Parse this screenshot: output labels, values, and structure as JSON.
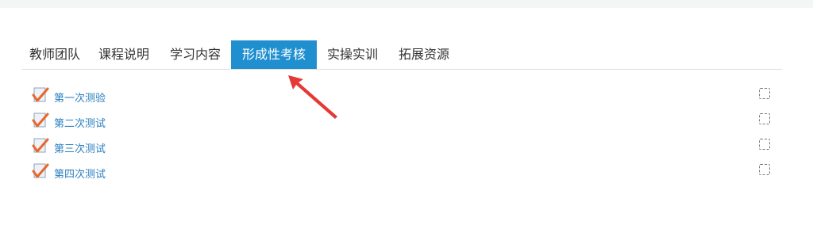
{
  "tabs": [
    {
      "label": "教师团队",
      "active": false
    },
    {
      "label": "课程说明",
      "active": false
    },
    {
      "label": "学习内容",
      "active": false
    },
    {
      "label": "形成性考核",
      "active": true
    },
    {
      "label": "实操实训",
      "active": false
    },
    {
      "label": "拓展资源",
      "active": false
    }
  ],
  "activities": [
    {
      "label": "第一次测验",
      "icon": "quiz-check-icon",
      "completed": false
    },
    {
      "label": "第二次测试",
      "icon": "quiz-check-icon",
      "completed": false
    },
    {
      "label": "第三次测试",
      "icon": "quiz-check-icon",
      "completed": false
    },
    {
      "label": "第四次测试",
      "icon": "quiz-check-icon",
      "completed": false
    }
  ],
  "colors": {
    "active_tab": "#1f8fd0",
    "link": "#2a7fbf",
    "check": "#e8672e",
    "annotation_arrow": "#e53935"
  },
  "annotation": {
    "icon": "red-arrow-icon"
  }
}
